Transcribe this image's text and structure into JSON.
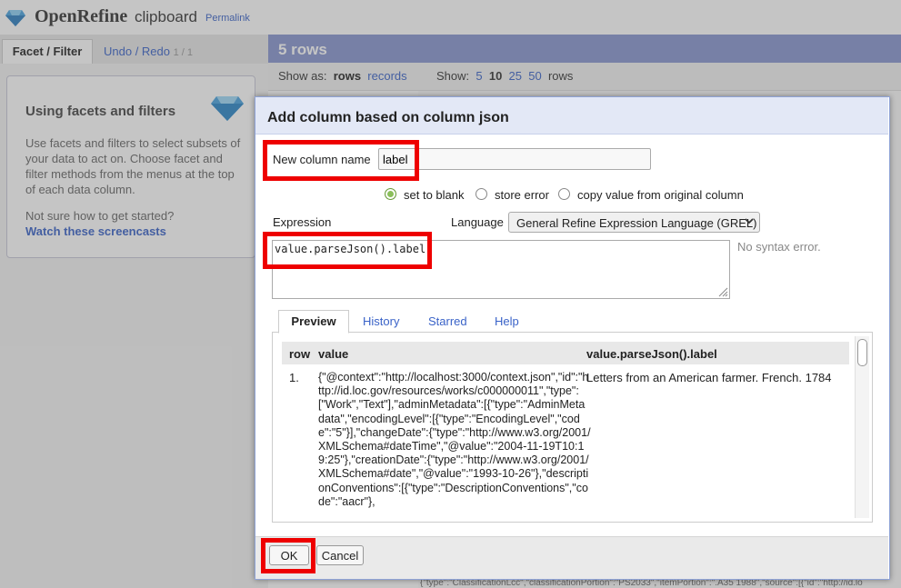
{
  "app": {
    "logo_text": "OpenRefine",
    "project_name": "clipboard",
    "permalink": "Permalink",
    "colors": {
      "accent_blue": "#8896cf",
      "link": "#3a63c8",
      "highlight": "#e00000"
    }
  },
  "left_panel": {
    "tab_facet": "Facet / Filter",
    "tab_undo": "Undo / Redo",
    "tab_undo_count": "1 / 1",
    "help_title": "Using facets and filters",
    "help_desc": "Use facets and filters to select subsets of your data to act on. Choose facet and filter methods from the menus at the top of each data column.",
    "help_question": "Not sure how to get started?",
    "help_link": "Watch these screencasts"
  },
  "main": {
    "rows_title": "5 rows",
    "show_as_label": "Show as:",
    "show_as_rows": "rows",
    "show_as_records": "records",
    "show_label": "Show:",
    "page_sizes": [
      "5",
      "10",
      "25",
      "50"
    ],
    "rows_suffix": "rows",
    "data_snippet": "{\"type\":\"ClassificationLcc\",\"classificationPortion\":\"PS2033\",\"itemPortion\":\".A35 1988\",\"source\":[{\"id\":\"http://id.lo"
  },
  "dialog": {
    "title": "Add column based on column json",
    "new_column_label": "New column name",
    "new_column_value": "label",
    "on_error_options": [
      "set to blank",
      "store error",
      "copy value from original column"
    ],
    "expression_label": "Expression",
    "language_label": "Language",
    "language_value": "General Refine Expression Language (GREL)",
    "expression_value": "value.parseJson().label",
    "syntax_status": "No syntax error.",
    "tabs": [
      "Preview",
      "History",
      "Starred",
      "Help"
    ],
    "preview": {
      "col_row": "row",
      "col_value": "value",
      "col_result": "value.parseJson().label",
      "row_num": "1.",
      "row_value": "{\"@context\":\"http://localhost:3000/context.json\",\"id\":\"http://id.loc.gov/resources/works/c000000011\",\"type\":[\"Work\",\"Text\"],\"adminMetadata\":[{\"type\":\"AdminMetadata\",\"encodingLevel\":[{\"type\":\"EncodingLevel\",\"code\":\"5\"}],\"changeDate\":{\"type\":\"http://www.w3.org/2001/XMLSchema#dateTime\",\"@value\":\"2004-11-19T10:19:25\"},\"creationDate\":{\"type\":\"http://www.w3.org/2001/XMLSchema#date\",\"@value\":\"1993-10-26\"},\"descriptionConventions\":[{\"type\":\"DescriptionConventions\",\"code\":\"aacr\"},",
      "row_result": "Letters from an American farmer. French. 1784"
    },
    "ok_label": "OK",
    "cancel_label": "Cancel"
  }
}
